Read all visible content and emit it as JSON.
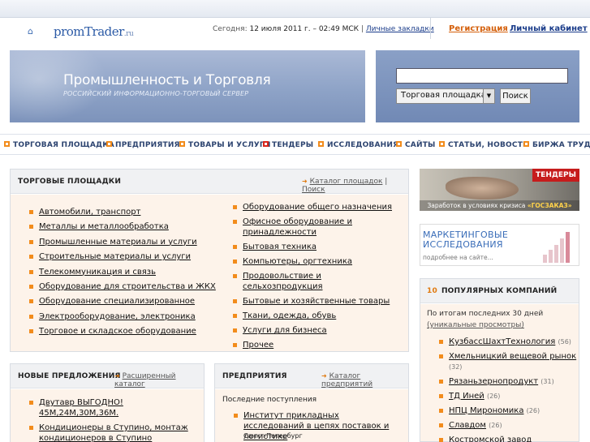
{
  "header": {
    "logo": "promTrader",
    "logo_suffix": ".ru",
    "date_prefix": "Сегодня:",
    "date_value": "12 июля 2011 г. – 02:49 МСК",
    "separator": "|",
    "bookmarks": "Личные закладки",
    "register": "Регистрация",
    "cabinet": "Личный кабинет"
  },
  "banner": {
    "title": "Промышленность и Торговля",
    "subtitle": "РОССИЙСКИЙ ИНФОРМАЦИОННО-ТОРГОВЫЙ СЕРВЕР"
  },
  "search": {
    "value": "",
    "select_value": "Торговая площадка",
    "button": "Поиск"
  },
  "nav": [
    {
      "label": "ТОРГОВАЯ ПЛОЩАДКА"
    },
    {
      "label": "ПРЕДПРИЯТИЯ"
    },
    {
      "label": "ТОВАРЫ И УСЛУГИ"
    },
    {
      "label": "ТЕНДЕРЫ"
    },
    {
      "label": "ИССЛЕДОВАНИЯ"
    },
    {
      "label": "САЙТЫ"
    },
    {
      "label": "СТАТЬИ, НОВОСТИ"
    },
    {
      "label": "БИРЖА ТРУДА"
    }
  ],
  "trade": {
    "title": "ТОРГОВЫЕ ПЛОЩАДКИ",
    "catalog_link": "Каталог площадок",
    "sep": "|",
    "search_link": "Поиск",
    "left": [
      "Автомобили, транспорт",
      "Металлы и металлообработка",
      "Промышленные материалы и услуги",
      "Строительные материалы и услуги",
      "Телекоммуникация и связь",
      "Оборудование для строительства и ЖКХ",
      "Оборудование специализированное",
      "Электрооборудование, электроника",
      "Торговое и складское оборудование"
    ],
    "right": [
      "Оборудование общего назначения",
      "Офисное оборудование и принадлежности",
      "Бытовая техника",
      "Компьютеры, оргтехника",
      "Продовольствие и сельхозпродукция",
      "Бытовые и хозяйственные товары",
      "Ткани, одежда, обувь",
      "Услуги для бизнеса",
      "Прочее"
    ]
  },
  "offers": {
    "title": "НОВЫЕ ПРЕДЛОЖЕНИЯ",
    "link": "Расширенный каталог",
    "items": [
      "Двутавр ВЫГОДНО! 45М,24М,30М,36М.",
      "Кондиционеры в Ступино, монтаж кондиционеров в Ступино"
    ]
  },
  "companies": {
    "title": "ПРЕДПРИЯТИЯ",
    "link": "Каталог предприятий",
    "subtitle": "Последние поступления",
    "items": [
      {
        "name": "Институт прикладных исследований в цепях поставок и логистике",
        "city": "Санкт-Петербург"
      }
    ]
  },
  "ads": {
    "tenders_tag": "ТЕНДЕРЫ",
    "tenders_caption_pre": "Заработок в условиях кризиса",
    "tenders_caption_brand": "«ГОСЗАКАЗ»",
    "marketing_line1": "МАРКЕТИНГОВЫЕ",
    "marketing_line2": "ИССЛЕДОВАНИЯ",
    "marketing_more": "подробнее на сайте..."
  },
  "top10": {
    "number": "10",
    "title": "ПОПУЛЯРНЫХ КОМПАНИЙ",
    "desc": "По итогам последних 30 дней",
    "desc_link": "(уникальные просмотры)",
    "items": [
      {
        "name": "КузбассШахтТехнология",
        "count": "(56)"
      },
      {
        "name": "Хмельницкий вещевой рынок",
        "count": "(32)"
      },
      {
        "name": "Рязаньзернопродукт",
        "count": "(31)"
      },
      {
        "name": "ТД Иней",
        "count": "(26)"
      },
      {
        "name": "НПЦ Мирономика",
        "count": "(26)"
      },
      {
        "name": "Славдом",
        "count": "(26)"
      },
      {
        "name": "Костромской завод Вольнотехники",
        "count": ""
      }
    ]
  }
}
